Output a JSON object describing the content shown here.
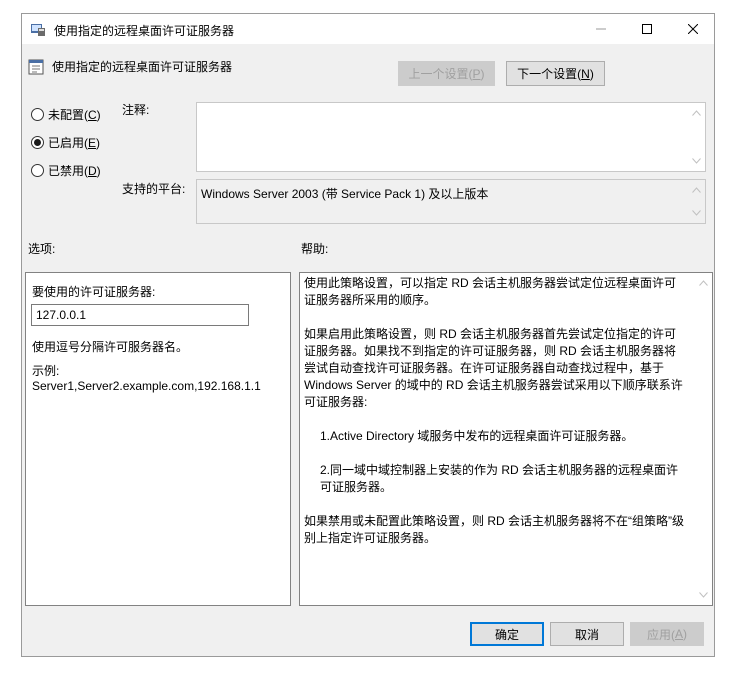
{
  "window": {
    "title": "使用指定的远程桌面许可证服务器",
    "minimize_icon": "minimize-icon",
    "maximize_icon": "maximize-icon",
    "close_icon": "close-icon"
  },
  "header": {
    "policy_title": "使用指定的远程桌面许可证服务器",
    "prev_setting_label": "上一个设置(",
    "prev_setting_key": "P",
    "next_setting_label": "下一个设置(",
    "next_setting_key": "N",
    "paren_close": ")"
  },
  "state": {
    "options": [
      {
        "label": "未配置(",
        "key": "C",
        "checked": false
      },
      {
        "label": "已启用(",
        "key": "E",
        "checked": true
      },
      {
        "label": "已禁用(",
        "key": "D",
        "checked": false
      }
    ]
  },
  "comment": {
    "label": "注释:",
    "value": ""
  },
  "platform": {
    "label": "支持的平台:",
    "value": "Windows Server 2003 (带 Service Pack 1) 及以上版本"
  },
  "options_section": {
    "label": "选项:",
    "server_label": "要使用的许可证服务器:",
    "server_value": "127.0.0.1",
    "hint": "使用逗号分隔许可服务器名。",
    "example_label": "示例:",
    "example_value": "Server1,Server2.example.com,192.168.1.1"
  },
  "help_section": {
    "label": "帮助:",
    "paragraphs": [
      "使用此策略设置，可以指定 RD 会话主机服务器尝试定位远程桌面许可证服务器所采用的顺序。",
      "如果启用此策略设置，则 RD 会话主机服务器首先尝试定位指定的许可证服务器。如果找不到指定的许可证服务器，则 RD 会话主机服务器将尝试自动查找许可证服务器。在许可证服务器自动查找过程中，基于 Windows Server 的域中的 RD 会话主机服务器尝试采用以下顺序联系许可证服务器:",
      "1.Active Directory 域服务中发布的远程桌面许可证服务器。",
      "2.同一域中域控制器上安装的作为 RD 会话主机服务器的远程桌面许可证服务器。",
      "如果禁用或未配置此策略设置，则 RD 会话主机服务器将不在“组策略”级别上指定许可证服务器。"
    ]
  },
  "footer": {
    "ok_label": "确定",
    "cancel_label": "取消",
    "apply_label": "应用(",
    "apply_key": "A",
    "paren_close": ")"
  },
  "colors": {
    "window_bg": "#f0f0f0",
    "focus_border": "#0078d7"
  }
}
